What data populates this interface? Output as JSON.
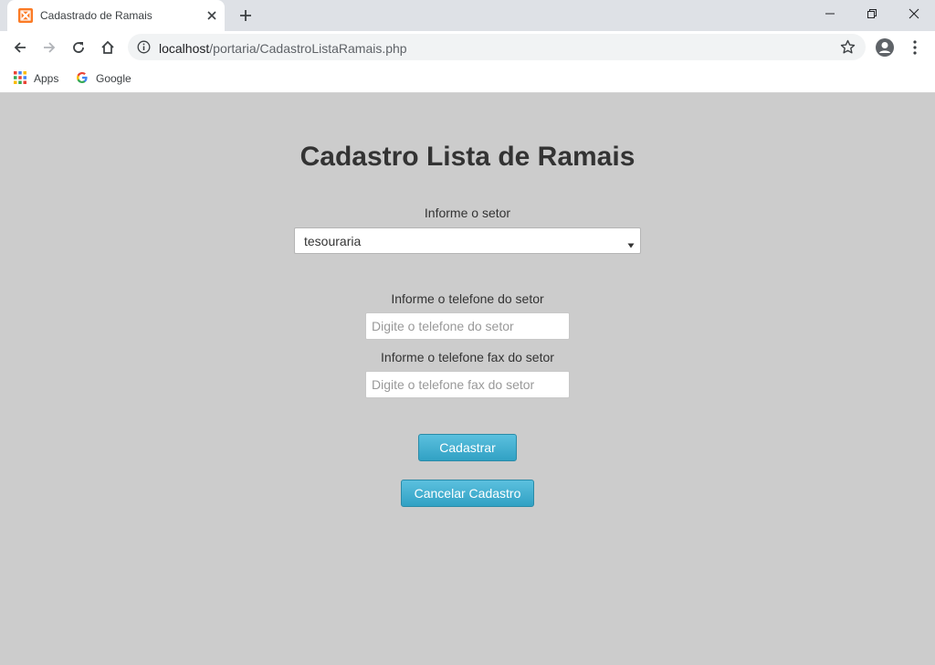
{
  "browser": {
    "tab_title": "Cadastrado de Ramais",
    "url_host": "localhost",
    "url_path": "/portaria/CadastroListaRamais.php",
    "bookmarks": [
      {
        "label": "Apps",
        "icon": "apps-grid-icon"
      },
      {
        "label": "Google",
        "icon": "google-icon"
      }
    ]
  },
  "form": {
    "title": "Cadastro Lista de Ramais",
    "setor_label": "Informe o setor",
    "setor_selected": "tesouraria",
    "telefone_label": "Informe o telefone do setor",
    "telefone_placeholder": "Digite o telefone do setor",
    "telefone_value": "",
    "fax_label": "Informe o telefone fax do setor",
    "fax_placeholder": "Digite o telefone fax do setor",
    "fax_value": "",
    "submit_label": "Cadastrar",
    "cancel_label": "Cancelar Cadastro"
  },
  "colors": {
    "page_background": "#cccccc",
    "button_top": "#5bc0de",
    "button_bottom": "#31a1c4",
    "favicon": "#fb7a24"
  }
}
